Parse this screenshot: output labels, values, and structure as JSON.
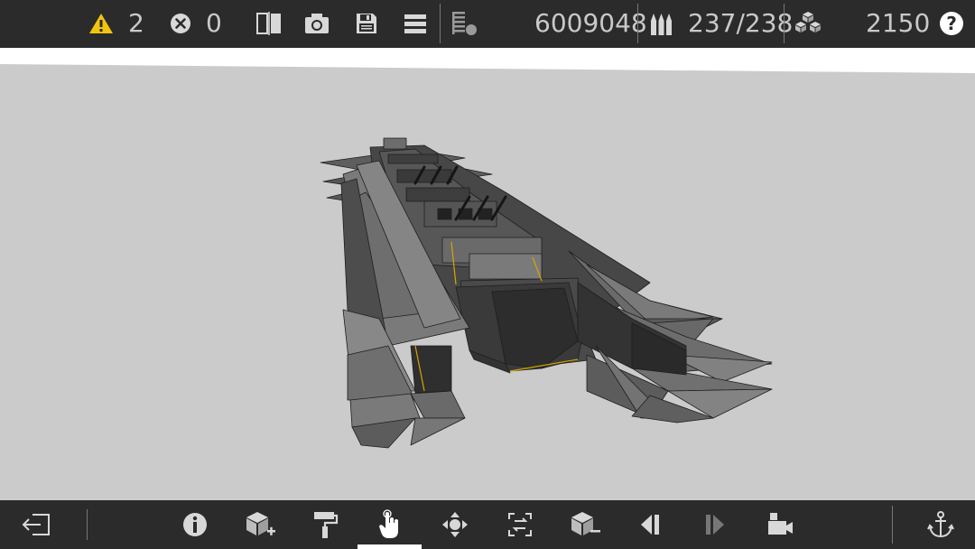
{
  "toolbar_top": {
    "warnings_count": "2",
    "errors_count": "0",
    "cost_value": "6009048",
    "ammo_value": "237/238",
    "blocks_value": "2150",
    "help_label": "?",
    "icons": [
      "warning-icon",
      "error-icon",
      "symmetry-icon",
      "camera-icon",
      "save-icon",
      "menu-icon",
      "stats-icon",
      "ammo-icon",
      "blocks-icon",
      "help-icon"
    ]
  },
  "toolbar_bottom": {
    "icons": [
      "exit-icon",
      "info-icon",
      "add-block-icon",
      "paint-roller-icon",
      "pointer-hand-icon",
      "move-icon",
      "rotate-frame-icon",
      "remove-block-icon",
      "undo-icon",
      "redo-icon",
      "camera-view-icon",
      "anchor-icon"
    ],
    "active_tool": "pointer-hand-icon"
  },
  "colors": {
    "bar_bg": "#2b2b2b",
    "icon_color": "#d8d8d8",
    "warning_yellow": "#f1c40f",
    "viewport_bg": "#cbcbcb",
    "horizon_white": "#ffffff",
    "hull_dark": "#3a3a3a",
    "hull_mid": "#6e6e6e",
    "hull_light": "#8a8a8a",
    "edge_accent": "#d9a300"
  }
}
